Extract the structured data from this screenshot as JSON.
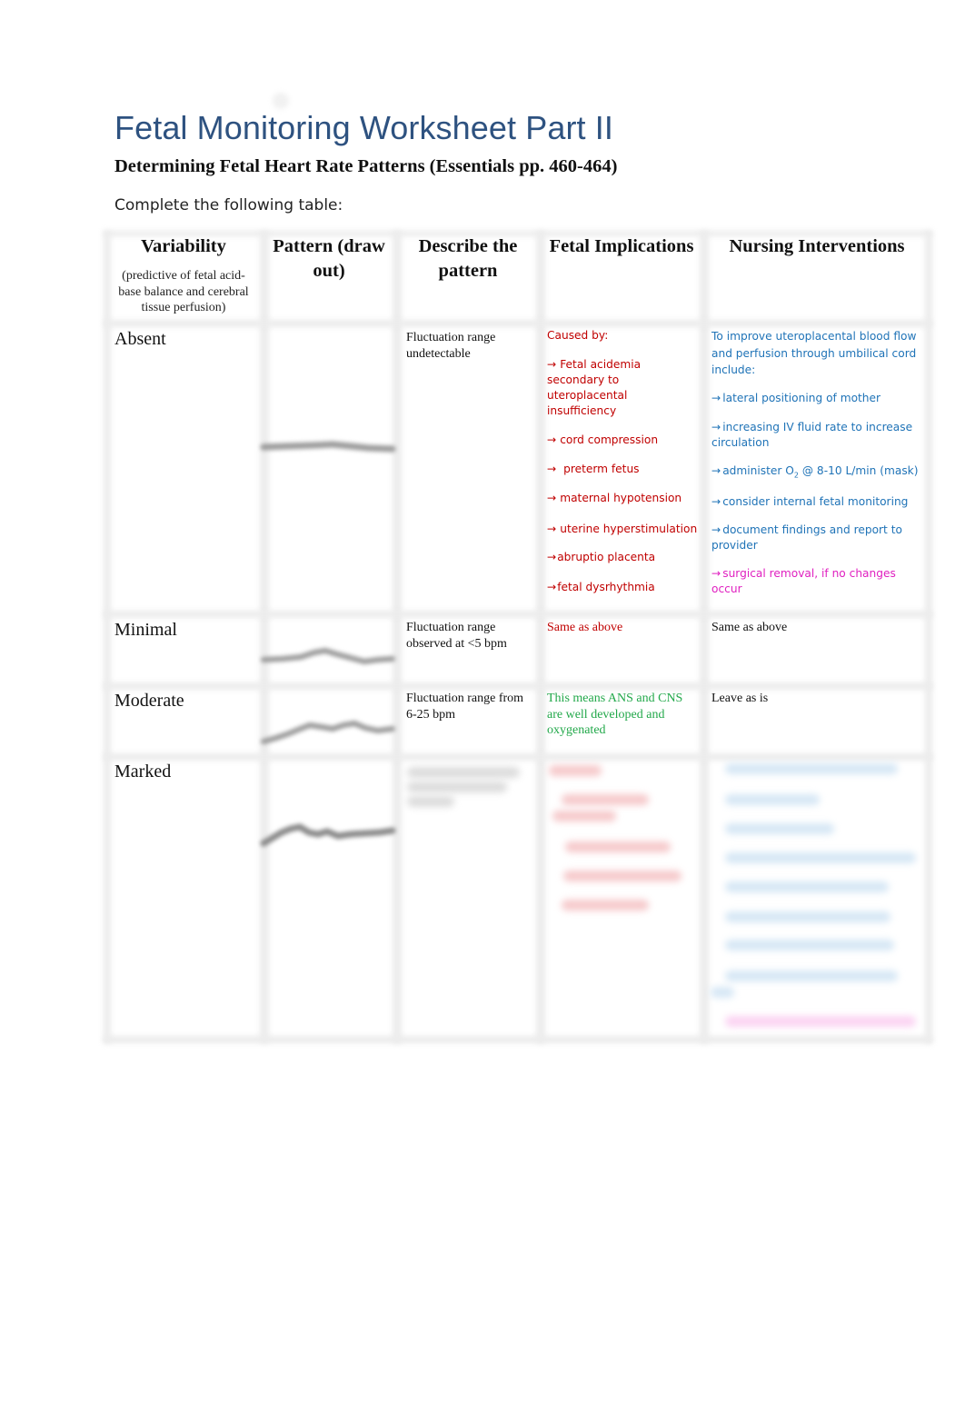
{
  "document": {
    "title": "Fetal Monitoring Worksheet Part II",
    "subtitle": "Determining Fetal Heart Rate Patterns (Essentials pp. 460-464)",
    "instruction": "Complete the following table:"
  },
  "table": {
    "headers": {
      "variability": "Variability",
      "variability_note": "(predictive of fetal acid-base balance and cerebral tissue perfusion)",
      "pattern": "Pattern (draw out)",
      "describe": "Describe the pattern",
      "implications": "Fetal Implications",
      "interventions": "Nursing Interventions"
    },
    "rows": {
      "absent": {
        "label": "Absent",
        "pattern_icon": "flat-fhr-trace-sketch",
        "description": "Fluctuation range undetectable",
        "implications_intro": "Caused by:",
        "implications": [
          "Fetal acidemia secondary to uteroplacental insufficiency",
          "cord compression",
          "preterm fetus",
          "maternal hypotension",
          "uterine hyperstimulation",
          "abruptio placenta",
          "fetal dysrhythmia"
        ],
        "interventions_intro": "To improve uteroplacental blood flow and perfusion through umbilical cord include:",
        "interventions": [
          "lateral positioning of mother",
          "increasing IV fluid rate to increase circulation",
          "consider internal fetal monitoring",
          "document findings and report to provider"
        ],
        "oxygen_intervention": {
          "prefix": "administer O",
          "subscript": "2",
          "suffix": " @ 8-10 L/min (mask)"
        },
        "final_intervention": "surgical removal, if no changes occur",
        "arrow_glyph": "→"
      },
      "minimal": {
        "label": "Minimal",
        "pattern_icon": "minimal-fhr-trace-sketch",
        "description": "Fluctuation range observed at <5 bpm",
        "implications": "Same as above",
        "interventions": "Same as above"
      },
      "moderate": {
        "label": "Moderate",
        "pattern_icon": "moderate-fhr-trace-sketch",
        "description": "Fluctuation range from 6-25 bpm",
        "implications": "This means ANS and CNS are well developed and oxygenated",
        "interventions": "Leave as is"
      },
      "marked": {
        "label": "Marked",
        "pattern_icon": "marked-fhr-trace-sketch",
        "content_state": "obscured"
      }
    }
  },
  "colors": {
    "title": "#2e5280",
    "implications_text": "#c00000",
    "interventions_text": "#1f73b7",
    "escalation_text": "#e020c0",
    "reassuring_text": "#22a84a"
  }
}
